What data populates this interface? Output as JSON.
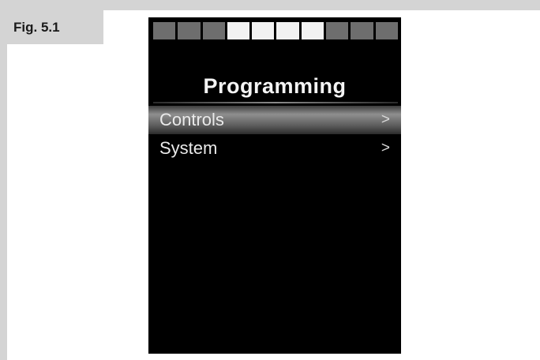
{
  "figure": {
    "label": "Fig. 5.1"
  },
  "screen": {
    "level_bar": {
      "total_segments": 10,
      "lit_segments": [
        3,
        4,
        5,
        6
      ]
    },
    "title": "Programming",
    "menu": [
      {
        "label": "Controls",
        "chevron": ">",
        "selected": true
      },
      {
        "label": "System",
        "chevron": ">",
        "selected": false
      }
    ]
  },
  "colors": {
    "screen_background": "#000000",
    "segment_off": "#6e6e6e",
    "segment_on": "#f2f2f2",
    "frame_gray": "#d4d4d4"
  }
}
